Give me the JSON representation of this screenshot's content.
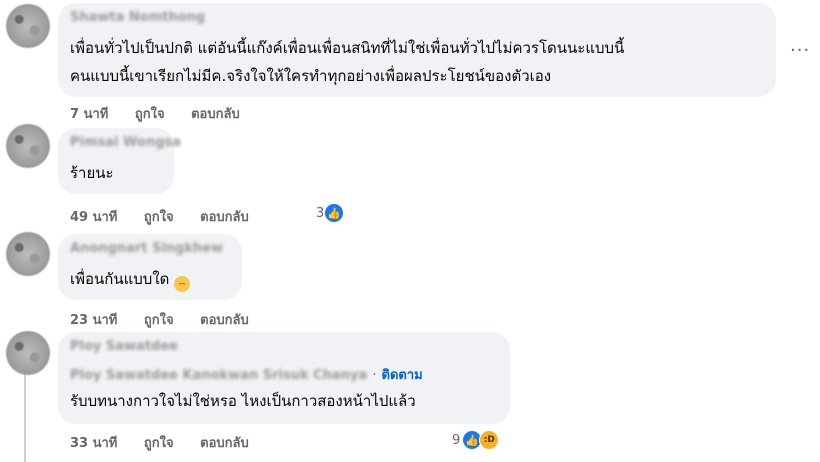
{
  "comments": [
    {
      "author": "Shawta Nomthong",
      "lines": [
        "เพื่อนทั่วไปเป็นปกติ แต่อันนี้แก๊งค์เพื่อนเพื่อนสนิทที่ไม่ใช่เพื่อนทั่วไปไม่ควรโดนนะแบบนี้",
        "คนแบบนี้เขาเรียกไม่มีค.จริงใจให้ใครทำทุกอย่างเพื่อผลประโยชน์ของตัวเอง"
      ],
      "time": "7 นาที",
      "like": "ถูกใจ",
      "reply": "ตอบกลับ"
    },
    {
      "author": "Pimsai Wongsa",
      "lines": [
        "ร้ายนะ"
      ],
      "time": "49 นาที",
      "like": "ถูกใจ",
      "reply": "ตอบกลับ",
      "reaction_count": "3"
    },
    {
      "author": "Anongnart Singkhew",
      "lines": [
        "เพื่อนกันแบบใด"
      ],
      "time": "23 นาที",
      "like": "ถูกใจ",
      "reply": "ตอบกลับ"
    },
    {
      "author": "Ploy Sawatdee",
      "author_line2": "Ploy Sawatdee Kanokwan Srisuk Chanya",
      "follow": "ติดตาม",
      "lines": [
        "รับบทนางกาวใจไม่ใช่หรอ ไหงเป็นกาวสองหน้าไปแล้ว"
      ],
      "time": "33 นาที",
      "like": "ถูกใจ",
      "reply": "ตอบกลับ",
      "reaction_count": "9"
    }
  ],
  "more_options": "···",
  "icons": {
    "like": "like-icon",
    "haha": "haha-icon",
    "more": "more-options-icon",
    "emoji": "unamused-face-icon"
  },
  "colors": {
    "bubble": "#f0f2f5",
    "meta": "#65676b",
    "link": "#0064d1",
    "like": "#1877f2"
  }
}
